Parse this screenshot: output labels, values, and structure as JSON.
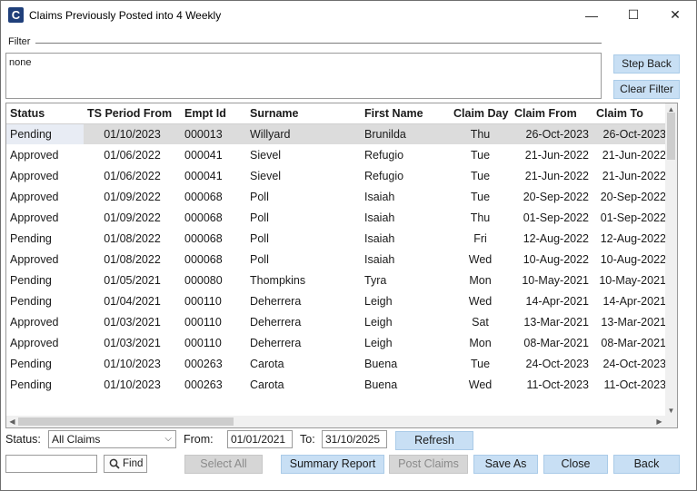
{
  "window": {
    "app_icon_letter": "C",
    "title": "Claims Previously Posted into 4 Weekly",
    "minimize": "—",
    "maximize": "☐",
    "close": "✕"
  },
  "filter": {
    "label": "Filter",
    "value": "none",
    "step_back_label": "Step Back",
    "clear_filter_label": "Clear Filter"
  },
  "grid": {
    "columns": [
      "Status",
      "TS Period From",
      "Empt Id",
      "Surname",
      "First Name",
      "Claim Day",
      "Claim From",
      "Claim To"
    ],
    "rows": [
      {
        "status": "Pending",
        "ts_period_from": "01/10/2023",
        "empt_id": "000013",
        "surname": "Willyard",
        "first_name": "Brunilda",
        "claim_day": "Thu",
        "claim_from": "26-Oct-2023",
        "claim_to": "26-Oct-2023"
      },
      {
        "status": "Approved",
        "ts_period_from": "01/06/2022",
        "empt_id": "000041",
        "surname": "Sievel",
        "first_name": "Refugio",
        "claim_day": "Tue",
        "claim_from": "21-Jun-2022",
        "claim_to": "21-Jun-2022"
      },
      {
        "status": "Approved",
        "ts_period_from": "01/06/2022",
        "empt_id": "000041",
        "surname": "Sievel",
        "first_name": "Refugio",
        "claim_day": "Tue",
        "claim_from": "21-Jun-2022",
        "claim_to": "21-Jun-2022"
      },
      {
        "status": "Approved",
        "ts_period_from": "01/09/2022",
        "empt_id": "000068",
        "surname": "Poll",
        "first_name": "Isaiah",
        "claim_day": "Tue",
        "claim_from": "20-Sep-2022",
        "claim_to": "20-Sep-2022"
      },
      {
        "status": "Approved",
        "ts_period_from": "01/09/2022",
        "empt_id": "000068",
        "surname": "Poll",
        "first_name": "Isaiah",
        "claim_day": "Thu",
        "claim_from": "01-Sep-2022",
        "claim_to": "01-Sep-2022"
      },
      {
        "status": "Pending",
        "ts_period_from": "01/08/2022",
        "empt_id": "000068",
        "surname": "Poll",
        "first_name": "Isaiah",
        "claim_day": "Fri",
        "claim_from": "12-Aug-2022",
        "claim_to": "12-Aug-2022"
      },
      {
        "status": "Approved",
        "ts_period_from": "01/08/2022",
        "empt_id": "000068",
        "surname": "Poll",
        "first_name": "Isaiah",
        "claim_day": "Wed",
        "claim_from": "10-Aug-2022",
        "claim_to": "10-Aug-2022"
      },
      {
        "status": "Pending",
        "ts_period_from": "01/05/2021",
        "empt_id": "000080",
        "surname": "Thompkins",
        "first_name": "Tyra",
        "claim_day": "Mon",
        "claim_from": "10-May-2021",
        "claim_to": "10-May-2021"
      },
      {
        "status": "Pending",
        "ts_period_from": "01/04/2021",
        "empt_id": "000110",
        "surname": "Deherrera",
        "first_name": "Leigh",
        "claim_day": "Wed",
        "claim_from": "14-Apr-2021",
        "claim_to": "14-Apr-2021"
      },
      {
        "status": "Approved",
        "ts_period_from": "01/03/2021",
        "empt_id": "000110",
        "surname": "Deherrera",
        "first_name": "Leigh",
        "claim_day": "Sat",
        "claim_from": "13-Mar-2021",
        "claim_to": "13-Mar-2021"
      },
      {
        "status": "Approved",
        "ts_period_from": "01/03/2021",
        "empt_id": "000110",
        "surname": "Deherrera",
        "first_name": "Leigh",
        "claim_day": "Mon",
        "claim_from": "08-Mar-2021",
        "claim_to": "08-Mar-2021"
      },
      {
        "status": "Pending",
        "ts_period_from": "01/10/2023",
        "empt_id": "000263",
        "surname": "Carota",
        "first_name": "Buena",
        "claim_day": "Tue",
        "claim_from": "24-Oct-2023",
        "claim_to": "24-Oct-2023"
      },
      {
        "status": "Pending",
        "ts_period_from": "01/10/2023",
        "empt_id": "000263",
        "surname": "Carota",
        "first_name": "Buena",
        "claim_day": "Wed",
        "claim_from": "11-Oct-2023",
        "claim_to": "11-Oct-2023"
      }
    ]
  },
  "controls": {
    "status_label": "Status:",
    "status_value": "All Claims",
    "from_label": "From:",
    "from_value": "01/01/2021",
    "to_label": "To:",
    "to_value": "31/10/2025",
    "refresh_label": "Refresh",
    "search_value": "",
    "find_label": "Find",
    "select_all_label": "Select All",
    "summary_report_label": "Summary Report",
    "post_claims_label": "Post Claims",
    "save_as_label": "Save As",
    "close_label": "Close",
    "back_label": "Back"
  }
}
